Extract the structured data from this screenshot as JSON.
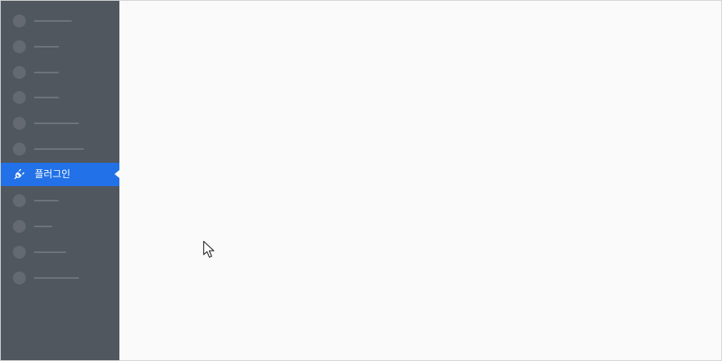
{
  "sidebar": {
    "active_item": {
      "label": "플러그인",
      "icon": "plugin-icon"
    },
    "accent_color": "#2271e8",
    "background_color": "#50575e"
  }
}
